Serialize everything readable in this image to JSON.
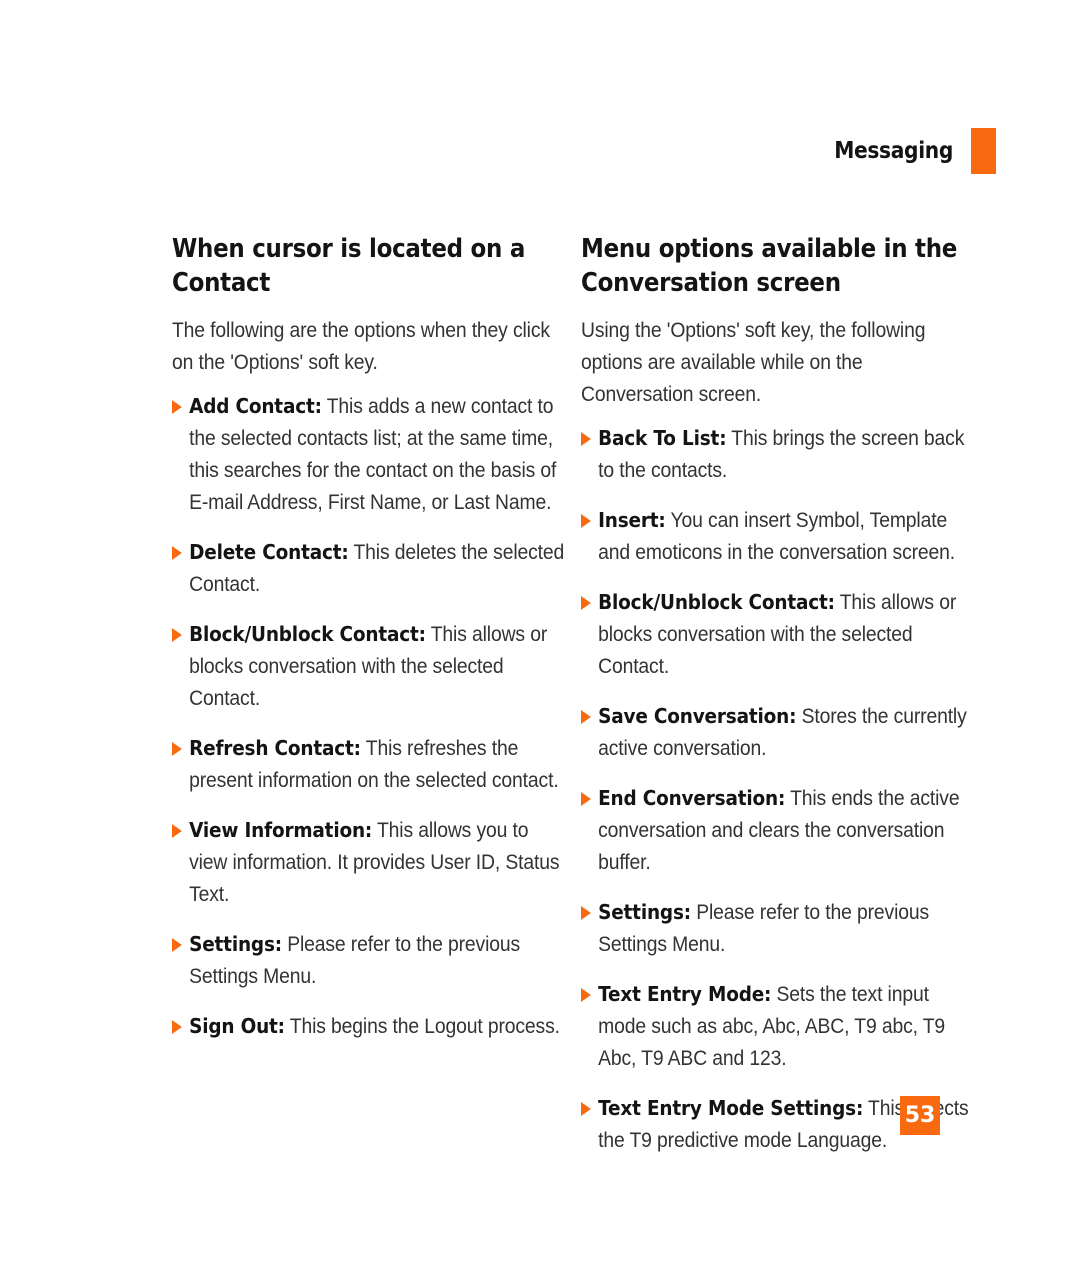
{
  "header": {
    "section_name": "Messaging",
    "marker_color": "#F96A10"
  },
  "page_number": "53",
  "accent_color": "#F96A10",
  "bullet_icon": "triangle-right-icon",
  "columns": [
    {
      "heading": "When cursor is located on a Contact",
      "intro": "The following are the options when they click on the 'Options' soft key.",
      "bullets": [
        {
          "label": "Add Contact:",
          "text": " This adds a new contact to the selected contacts list; at the same time, this searches for the contact on the basis of E-mail Address, First Name, or Last Name."
        },
        {
          "label": "Delete Contact:",
          "text": " This deletes the selected Contact."
        },
        {
          "label": "Block/Unblock Contact:",
          "text": " This allows or blocks conversation with the selected Contact."
        },
        {
          "label": "Refresh Contact:",
          "text": " This refreshes the present information on the selected contact."
        },
        {
          "label": "View Information:",
          "text": " This allows you to view information. It provides User ID, Status Text."
        },
        {
          "label": "Settings:",
          "text": " Please refer to the previous Settings Menu."
        },
        {
          "label": "Sign Out:",
          "text": " This begins the Logout process."
        }
      ]
    },
    {
      "heading": "Menu options available in the Conversation screen",
      "intro": "Using the 'Options' soft key, the following options are available while on the Conversation screen.",
      "bullets": [
        {
          "label": "Back To List:",
          "text": " This brings the screen back to the contacts."
        },
        {
          "label": "Insert:",
          "text": " You can insert Symbol, Template and emoticons in the conversation screen."
        },
        {
          "label": "Block/Unblock Contact:",
          "text": " This allows or blocks conversation with the selected Contact."
        },
        {
          "label": "Save Conversation:",
          "text": " Stores the currently active conversation."
        },
        {
          "label": "End Conversation:",
          "text": " This ends the active conversation and clears the conversation buffer."
        },
        {
          "label": "Settings:",
          "text": " Please refer to the previous Settings Menu."
        },
        {
          "label": "Text Entry Mode:",
          "text": " Sets the text input mode such as abc, Abc, ABC, T9 abc, T9 Abc, T9 ABC and 123."
        },
        {
          "label": "Text Entry Mode Settings:",
          "text": " This selects the T9 predictive mode Language."
        }
      ]
    }
  ]
}
